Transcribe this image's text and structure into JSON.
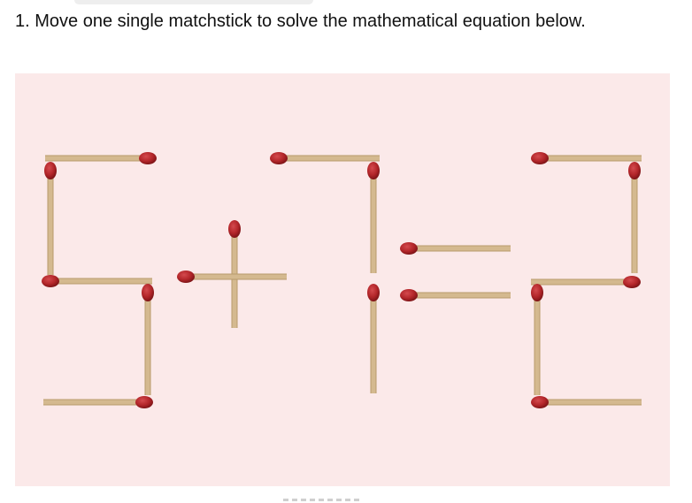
{
  "question": {
    "text": "1. Move one single matchstick to solve the mathematical equation below."
  },
  "puzzle": {
    "equation": "5+7=2",
    "colors": {
      "background": "#fbe9e9",
      "stick": "#d4b98f",
      "stick_edge": "#b89a6c",
      "head": "#b3262a",
      "head_dark": "#7e1417"
    }
  }
}
